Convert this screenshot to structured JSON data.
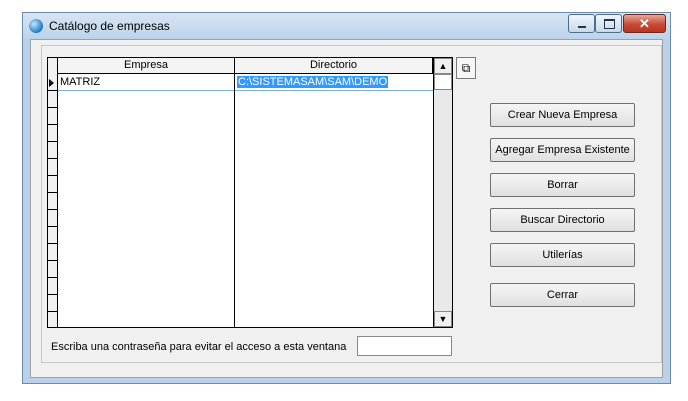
{
  "window": {
    "title": "Catálogo de empresas"
  },
  "grid": {
    "columns": [
      "Empresa",
      "Directorio"
    ],
    "rows": [
      {
        "empresa": "MATRIZ",
        "directorio": "C:\\SISTEMASAM\\SAM\\DEMO"
      }
    ]
  },
  "buttons": {
    "crear": "Crear Nueva Empresa",
    "agregar": "Agregar Empresa Existente",
    "borrar": "Borrar",
    "buscar": "Buscar Directorio",
    "utilerias": "Utilerías",
    "cerrar": "Cerrar"
  },
  "password": {
    "prompt": "Escriba una contraseña para evitar el acceso a esta ventana",
    "value": ""
  },
  "icons": {
    "app": "app-icon",
    "copy": "copy-icon",
    "minimize": "minimize-icon",
    "maximize": "maximize-icon",
    "close": "close-icon"
  }
}
